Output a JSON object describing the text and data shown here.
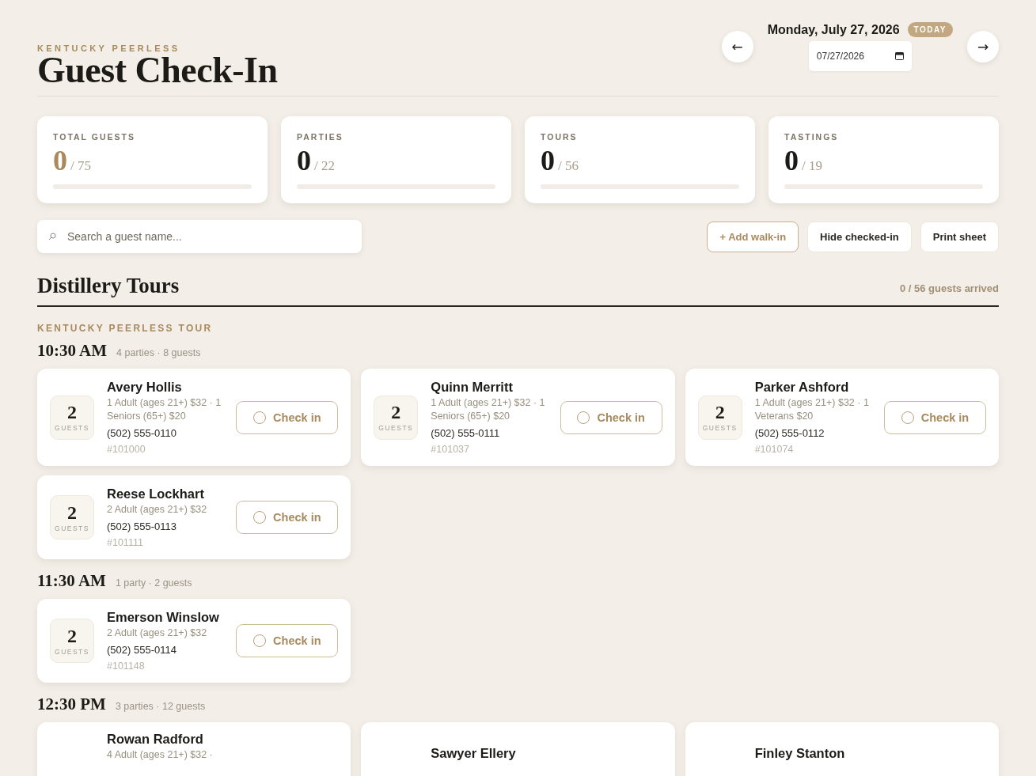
{
  "header": {
    "eyebrow": "KENTUCKY PEERLESS",
    "title": "Guest Check-In"
  },
  "date_nav": {
    "prev": "←",
    "date": "Monday, July 27, 2026",
    "badge": "TODAY",
    "date_field": "07/27/2026",
    "next": "→"
  },
  "stats": [
    {
      "label": "TOTAL GUESTS",
      "value": "0",
      "total": "/ 75",
      "kind": "accent",
      "level": 0
    },
    {
      "label": "PARTIES",
      "value": "0",
      "total": "/ 22",
      "kind": "plain",
      "level": 0
    },
    {
      "label": "TOURS",
      "value": "0",
      "total": "/ 56",
      "kind": "plain",
      "level": 0
    },
    {
      "label": "TASTINGS",
      "value": "0",
      "total": "/ 19",
      "kind": "plain",
      "level": 0
    }
  ],
  "search": {
    "placeholder": "Search a guest name..."
  },
  "actions": [
    {
      "label": "+ Add walk-in",
      "kind": "accent"
    },
    {
      "label": "Hide checked-in",
      "kind": "plain"
    },
    {
      "label": "Print sheet",
      "kind": "plain"
    }
  ],
  "section": {
    "title": "Distillery Tours",
    "summary": "0 / 56 guests arrived",
    "tour": "KENTUCKY PEERLESS TOUR",
    "slots": [
      {
        "time": "10:30 AM",
        "meta": "4 parties · 8 guests",
        "parties": [
          {
            "count": "2",
            "count_label": "GUESTS",
            "name": "Avery Hollis",
            "details": "1 Adult (ages 21+) $32 · 1 Seniors (65+) $20",
            "phone": "(502) 555-0110",
            "booking": "#101000",
            "button": "Check in",
            "checked_in": false
          },
          {
            "count": "2",
            "count_label": "GUESTS",
            "name": "Quinn Merritt",
            "details": "1 Adult (ages 21+) $32 · 1 Seniors (65+) $20",
            "phone": "(502) 555-0111",
            "booking": "#101037",
            "button": "Check in",
            "checked_in": false
          },
          {
            "count": "2",
            "count_label": "GUESTS",
            "name": "Parker Ashford",
            "details": "1 Adult (ages 21+) $32 · 1 Veterans $20",
            "phone": "(502) 555-0112",
            "booking": "#101074",
            "button": "Check in",
            "checked_in": false
          },
          {
            "count": "2",
            "count_label": "GUESTS",
            "name": "Reese Lockhart",
            "details": "2 Adult (ages 21+) $32",
            "phone": "(502) 555-0113",
            "booking": "#101111",
            "button": "Check in",
            "checked_in": false
          }
        ]
      },
      {
        "time": "11:30 AM",
        "meta": "1 party · 2 guests",
        "parties": [
          {
            "count": "2",
            "count_label": "GUESTS",
            "name": "Emerson Winslow",
            "details": "2 Adult (ages 21+) $32",
            "phone": "(502) 555-0114",
            "booking": "#101148",
            "button": "Check in",
            "checked_in": false
          }
        ]
      },
      {
        "time": "12:30 PM",
        "meta": "3 parties · 12 guests",
        "parties": [
          {
            "name": "Rowan Radford",
            "details": "4 Adult (ages 21+) $32 ·"
          },
          {
            "name": "Sawyer Ellery"
          },
          {
            "name": "Finley Stanton"
          }
        ]
      }
    ]
  }
}
